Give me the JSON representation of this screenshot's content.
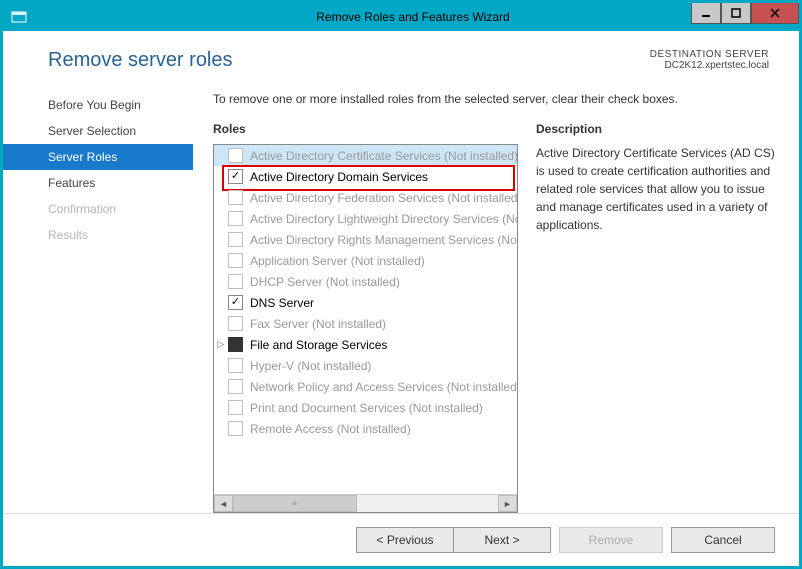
{
  "window": {
    "title": "Remove Roles and Features Wizard"
  },
  "destination": {
    "label": "DESTINATION SERVER",
    "value": "DC2K12.xpertstec.local"
  },
  "page_title": "Remove server roles",
  "instruction": "To remove one or more installed roles from the selected server, clear their check boxes.",
  "sidebar": {
    "items": [
      {
        "label": "Before You Begin",
        "state": "normal"
      },
      {
        "label": "Server Selection",
        "state": "normal"
      },
      {
        "label": "Server Roles",
        "state": "selected"
      },
      {
        "label": "Features",
        "state": "normal"
      },
      {
        "label": "Confirmation",
        "state": "disabled"
      },
      {
        "label": "Results",
        "state": "disabled"
      }
    ]
  },
  "columns": {
    "roles_head": "Roles",
    "desc_head": "Description"
  },
  "roles": [
    {
      "label": "Active Directory Certificate Services (Not installed)",
      "checked": false,
      "enabled": false,
      "selected": true
    },
    {
      "label": "Active Directory Domain Services",
      "checked": true,
      "enabled": true,
      "highlight": true
    },
    {
      "label": "Active Directory Federation Services (Not installed)",
      "checked": false,
      "enabled": false
    },
    {
      "label": "Active Directory Lightweight Directory Services (Not installed)",
      "checked": false,
      "enabled": false
    },
    {
      "label": "Active Directory Rights Management Services (Not installed)",
      "checked": false,
      "enabled": false
    },
    {
      "label": "Application Server (Not installed)",
      "checked": false,
      "enabled": false
    },
    {
      "label": "DHCP Server (Not installed)",
      "checked": false,
      "enabled": false
    },
    {
      "label": "DNS Server",
      "checked": true,
      "enabled": true
    },
    {
      "label": "Fax Server (Not installed)",
      "checked": false,
      "enabled": false
    },
    {
      "label": "File and Storage Services",
      "checked": "filled",
      "enabled": true,
      "expander": true
    },
    {
      "label": "Hyper-V (Not installed)",
      "checked": false,
      "enabled": false
    },
    {
      "label": "Network Policy and Access Services (Not installed)",
      "checked": false,
      "enabled": false
    },
    {
      "label": "Print and Document Services (Not installed)",
      "checked": false,
      "enabled": false
    },
    {
      "label": "Remote Access (Not installed)",
      "checked": false,
      "enabled": false
    }
  ],
  "description": "Active Directory Certificate Services (AD CS) is used to create certification authorities and related role services that allow you to issue and manage certificates used in a variety of applications.",
  "footer": {
    "previous": "< Previous",
    "next": "Next >",
    "remove": "Remove",
    "cancel": "Cancel"
  }
}
